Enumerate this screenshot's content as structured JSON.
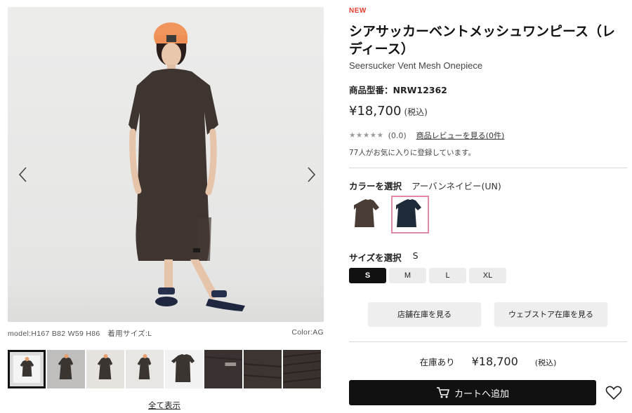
{
  "gallery": {
    "prev_icon": "chevron-left-icon",
    "next_icon": "chevron-right-icon",
    "model_info": "model:H167 B82 W59 H86　着用サイズ:L",
    "color_info": "Color:AG",
    "thumbnails": [
      {
        "label": "model-front-selected",
        "selected": true
      },
      {
        "label": "model-front"
      },
      {
        "label": "model-walking"
      },
      {
        "label": "model-side"
      },
      {
        "label": "garment-flat"
      },
      {
        "label": "fabric-logo"
      },
      {
        "label": "fabric-detail"
      },
      {
        "label": "fabric-texture"
      }
    ],
    "show_all": "全て表示"
  },
  "product": {
    "badge": "NEW",
    "title": "シアサッカーベントメッシュワンピース（レディース）",
    "subtitle": "Seersucker Vent Mesh Onepiece",
    "model_number": "商品型番：NRW12362",
    "price": "¥18,700",
    "tax_note": "(税込)",
    "rating_stars": "★★★★★",
    "rating_value": "(0.0)",
    "review_link": "商品レビューを見る(0件)",
    "favorites": "77人がお気に入りに登録しています。"
  },
  "color": {
    "label": "カラーを選択",
    "selected_name": "アーバンネイビー(UN)",
    "swatches": [
      {
        "name": "AG",
        "hex": "#4a3d36"
      },
      {
        "name": "UN",
        "hex": "#1e2a38",
        "selected": true
      }
    ]
  },
  "size": {
    "label": "サイズを選択",
    "selected_value": "S",
    "options": [
      "S",
      "M",
      "L",
      "XL"
    ]
  },
  "stock_buttons": {
    "store": "店舗在庫を見る",
    "web": "ウェブストア在庫を見る"
  },
  "purchase": {
    "stock_status": "在庫あり",
    "price": "¥18,700",
    "tax_note": "(税込)",
    "cart_label": "カートへ追加",
    "cart_icon": "cart-icon",
    "favorite_icon": "heart-icon"
  },
  "colors": {
    "accent_new": "#e63c2f",
    "cart_button": "#111111",
    "selected_swatch_border": "#e08aa5"
  }
}
